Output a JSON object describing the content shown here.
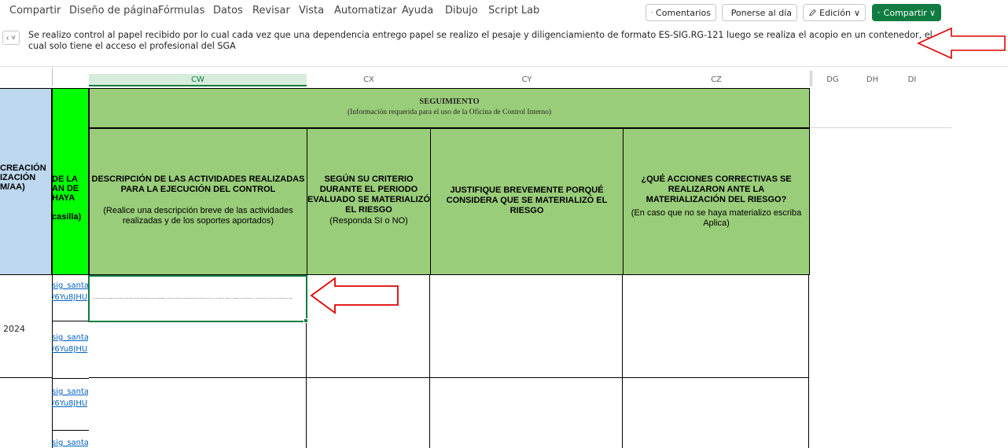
{
  "menu": [
    "Compartir",
    "Diseño de página",
    "Fórmulas",
    "Datos",
    "Revisar",
    "Vista",
    "Automatizar",
    "Ayuda",
    "Dibujo",
    "Script Lab"
  ],
  "toolbar": {
    "comments": "Comentarios",
    "catchup": "Ponerse al día",
    "editing": "Edición",
    "share": "Compartir"
  },
  "formula": {
    "namebox": "‹ ˅",
    "text": "Se realizo control al papel recibido por lo cual cada vez que una dependencia entrego papel se realizo el pesaje y diligenciamiento de formato ES-SIG.RG-121 luego se  realiza el acopio en un contenedor, el cual solo tiene el acceso el profesional del SGA"
  },
  "columns": {
    "cw": "CW",
    "cx": "CX",
    "cy": "CY",
    "cz": "CZ",
    "dg": "DG",
    "dh": "DH",
    "di": "DI"
  },
  "sheet": {
    "seguimiento_title": "SEGUIMIENTO",
    "seguimiento_sub": "(Información requerida para el uso de la Oficina de Control Interno)",
    "left_header": "CREACIÓN\nIZACIÓN\nM/AA)",
    "green_header": "DE LA\nAN DE\nHAYA\n\ncasilla)",
    "col_cw_title": "DESCRIPCIÓN DE LAS ACTIVIDADES REALIZADAS PARA LA EJECUCIÓN DEL CONTROL",
    "col_cw_sub": "(Realice una descripción breve de las actividades realizadas y de los soportes aportados)",
    "col_cx_title": "SEGÚN SU CRITERIO DURANTE EL PERIODO EVALUADO SE MATERIALIZÓ EL RIESGO",
    "col_cx_sub": "(Responda SI o NO)",
    "col_cy_title": "JUSTIFIQUE BREVEMENTE PORQUÉ CONSIDERA QUE SE MATERIALIZÓ EL RIESGO",
    "col_cz_title": "¿QUÉ ACCIONES CORRECTIVAS SE REALIZARON ANTE LA MATERIALIZACIÓN DEL RIESGO?",
    "col_cz_sub": "(En caso que no se haya materializo escriba Aplica)",
    "year_label": "2024",
    "links": [
      {
        "l1": "sig_santa",
        "l2": "/6Yu8JHU"
      },
      {
        "l1": "sig_santa",
        "l2": "/6Yu8JHU"
      },
      {
        "l1": "sig_santa",
        "l2": "/6Yu8JHU"
      },
      {
        "l1": "sig_santa",
        "l2": ""
      }
    ]
  }
}
